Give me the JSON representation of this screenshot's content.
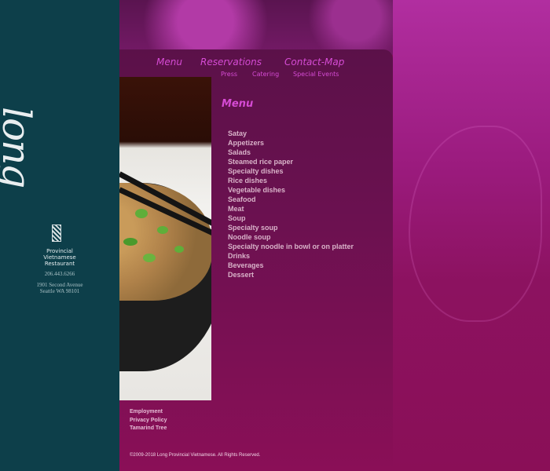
{
  "colors": {
    "sidebar": "#0d3f4a",
    "background": "#8a0f57",
    "accent": "#d54bd4",
    "menu_text": "#d9b3c9"
  },
  "brand": {
    "logo_text": "long",
    "tagline": [
      "Provincial",
      "Vietnamese",
      "Restaurant"
    ],
    "phone": "206.443.6266",
    "address_line1": "1901 Second Avenue",
    "address_line2": "Seattle WA 98101"
  },
  "nav": {
    "primary": [
      "Menu",
      "Reservations",
      "Contact-Map"
    ],
    "secondary": [
      "Press",
      "Catering",
      "Special Events"
    ]
  },
  "page": {
    "title": "Menu",
    "items": [
      "Satay",
      "Appetizers",
      "Salads",
      "Steamed rice paper",
      "Specialty dishes",
      "Rice dishes",
      "Vegetable dishes",
      "Seafood",
      "Meat",
      "Soup",
      "Specialty soup",
      "Noodle soup",
      "Specialty noodle in bowl or on platter",
      "Drinks",
      "Beverages",
      "Dessert"
    ]
  },
  "footer": {
    "links": [
      "Employment",
      "Privacy Policy",
      "Tamarind Tree"
    ],
    "copyright": "©2009-2018 Long Provincial Vietnamese. All Rights Reserved."
  }
}
